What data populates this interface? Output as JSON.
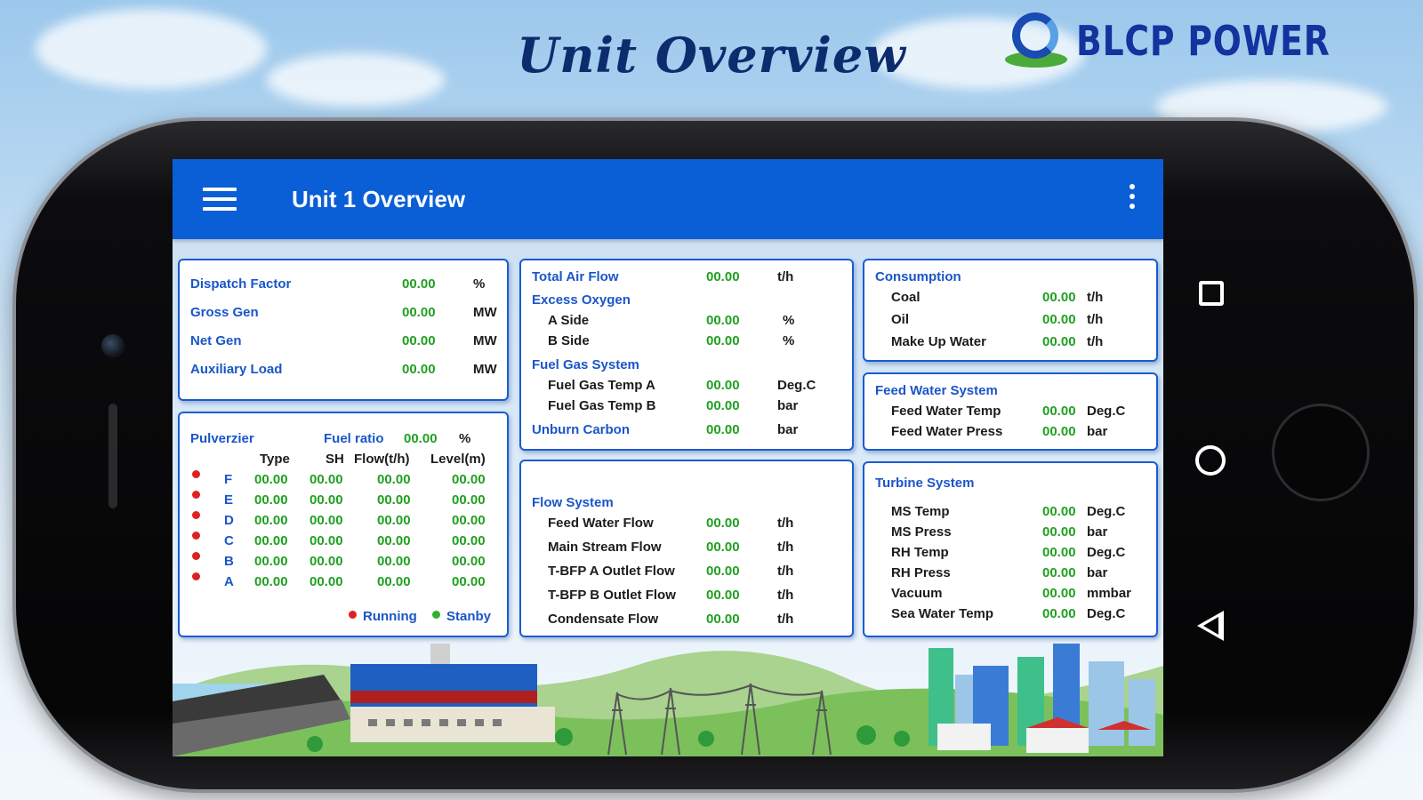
{
  "promo": {
    "title": "Unit Overview",
    "brand": "BLCP POWER"
  },
  "appbar": {
    "title": "Unit 1 Overview"
  },
  "dispatch": {
    "rows": [
      {
        "label": "Dispatch Factor",
        "value": "00.00",
        "unit": "%"
      },
      {
        "label": "Gross Gen",
        "value": "00.00",
        "unit": "MW"
      },
      {
        "label": "Net Gen",
        "value": "00.00",
        "unit": "MW"
      },
      {
        "label": "Auxiliary Load",
        "value": "00.00",
        "unit": "MW"
      }
    ]
  },
  "pulverizer": {
    "title": "Pulverzier",
    "fuel_ratio_label": "Fuel ratio",
    "fuel_ratio_value": "00.00",
    "fuel_ratio_unit": "%",
    "columns": [
      "Type",
      "SH",
      "Flow(t/h)",
      "Level(m)"
    ],
    "rows": [
      {
        "mill": "F",
        "type": "00.00",
        "sh": "00.00",
        "flow": "00.00",
        "level": "00.00",
        "status": "running"
      },
      {
        "mill": "E",
        "type": "00.00",
        "sh": "00.00",
        "flow": "00.00",
        "level": "00.00",
        "status": "running"
      },
      {
        "mill": "D",
        "type": "00.00",
        "sh": "00.00",
        "flow": "00.00",
        "level": "00.00",
        "status": "running"
      },
      {
        "mill": "C",
        "type": "00.00",
        "sh": "00.00",
        "flow": "00.00",
        "level": "00.00",
        "status": "running"
      },
      {
        "mill": "B",
        "type": "00.00",
        "sh": "00.00",
        "flow": "00.00",
        "level": "00.00",
        "status": "running"
      },
      {
        "mill": "A",
        "type": "00.00",
        "sh": "00.00",
        "flow": "00.00",
        "level": "00.00",
        "status": "running"
      }
    ],
    "legend_running": "Running",
    "legend_standby": "Stanby"
  },
  "air": {
    "total_air_flow": {
      "label": "Total Air Flow",
      "value": "00.00",
      "unit": "t/h"
    },
    "excess_oxygen": "Excess Oxygen",
    "a_side": {
      "label": "A Side",
      "value": "00.00",
      "unit": "%"
    },
    "b_side": {
      "label": "B Side",
      "value": "00.00",
      "unit": "%"
    },
    "fuel_gas_system": "Fuel Gas System",
    "fuel_gas_temp_a": {
      "label": "Fuel Gas Temp A",
      "value": "00.00",
      "unit": "Deg.C"
    },
    "fuel_gas_temp_b": {
      "label": "Fuel Gas Temp B",
      "value": "00.00",
      "unit": "bar"
    },
    "unburn_carbon": {
      "label": "Unburn Carbon",
      "value": "00.00",
      "unit": "bar"
    }
  },
  "flow": {
    "title": "Flow System",
    "rows": [
      {
        "label": "Feed Water Flow",
        "value": "00.00",
        "unit": "t/h"
      },
      {
        "label": "Main Stream Flow",
        "value": "00.00",
        "unit": "t/h"
      },
      {
        "label": "T-BFP A Outlet Flow",
        "value": "00.00",
        "unit": "t/h"
      },
      {
        "label": "T-BFP B Outlet Flow",
        "value": "00.00",
        "unit": "t/h"
      },
      {
        "label": "Condensate Flow",
        "value": "00.00",
        "unit": "t/h"
      }
    ]
  },
  "consumption": {
    "title": "Consumption",
    "rows": [
      {
        "label": "Coal",
        "value": "00.00",
        "unit": "t/h"
      },
      {
        "label": "Oil",
        "value": "00.00",
        "unit": "t/h"
      },
      {
        "label": "Make Up Water",
        "value": "00.00",
        "unit": "t/h"
      }
    ]
  },
  "feedwater": {
    "title": "Feed Water System",
    "rows": [
      {
        "label": "Feed Water Temp",
        "value": "00.00",
        "unit": "Deg.C"
      },
      {
        "label": "Feed Water Press",
        "value": "00.00",
        "unit": "bar"
      }
    ]
  },
  "turbine": {
    "title": "Turbine System",
    "rows": [
      {
        "label": "MS Temp",
        "value": "00.00",
        "unit": "Deg.C"
      },
      {
        "label": "MS Press",
        "value": "00.00",
        "unit": "bar"
      },
      {
        "label": "RH Temp",
        "value": "00.00",
        "unit": "Deg.C"
      },
      {
        "label": "RH Press",
        "value": "00.00",
        "unit": "bar"
      },
      {
        "label": "Vacuum",
        "value": "00.00",
        "unit": "mmbar"
      },
      {
        "label": "Sea Water Temp",
        "value": "00.00",
        "unit": "Deg.C"
      }
    ]
  },
  "colors": {
    "appbar": "#0a5ed6",
    "label_blue": "#1a56c9",
    "value_green": "#20a020",
    "status_running": "#e02020",
    "status_standby": "#30b030"
  }
}
